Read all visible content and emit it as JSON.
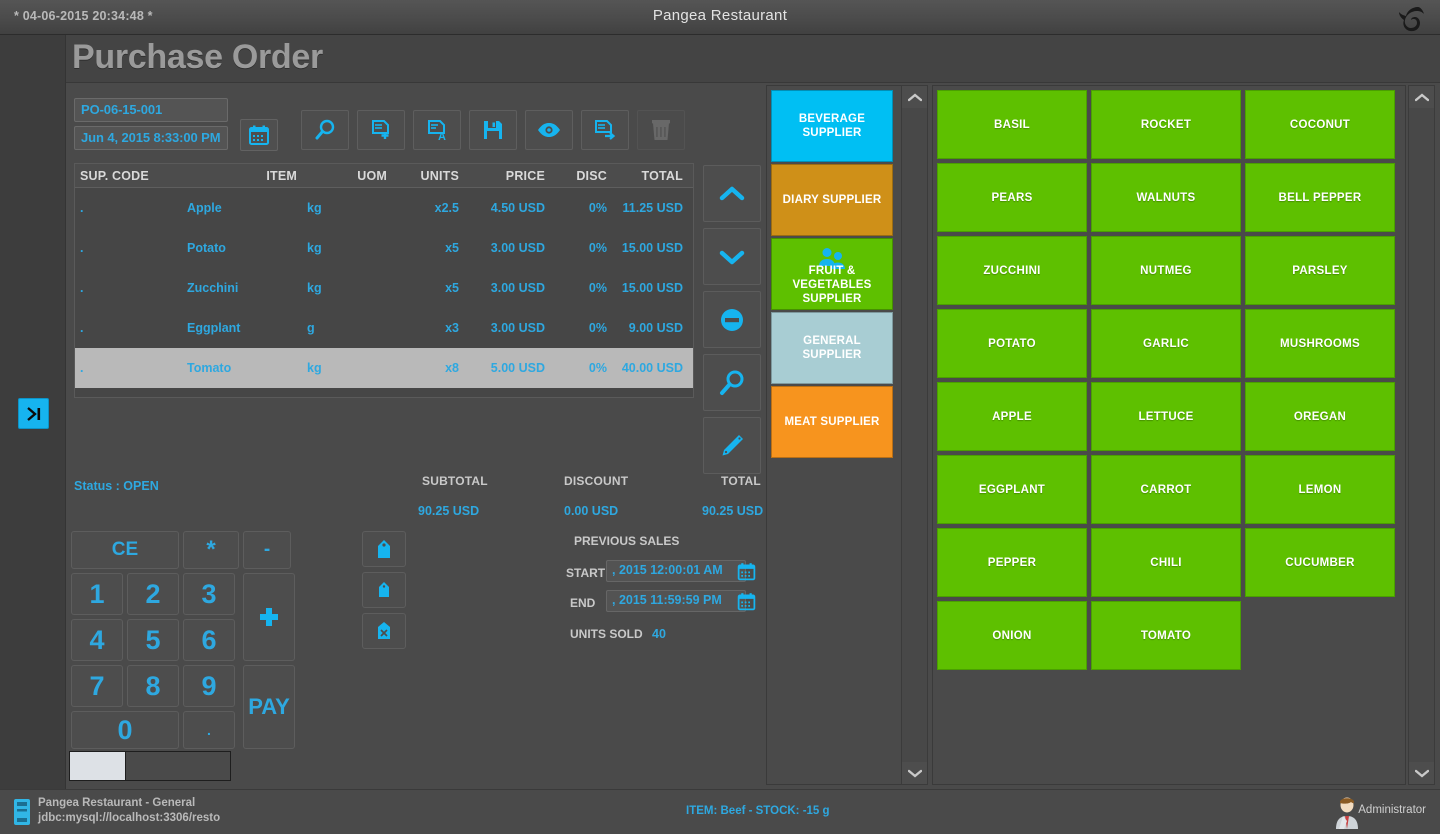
{
  "titlebar": {
    "clock": "* 04-06-2015 20:34:48 *",
    "app_title": "Pangea Restaurant",
    "logo_icon": "bird-logo-icon"
  },
  "header": {
    "page_title": "Purchase Order"
  },
  "left_rail": {
    "expand_icon": "expand-panel-icon"
  },
  "order": {
    "po_code": "PO-06-15-001",
    "po_date": "Jun 4, 2015 8:33:00 PM",
    "calendar_icon": "calendar-icon",
    "toolbar": [
      {
        "name": "search-order-button",
        "icon": "magnifier-icon",
        "disabled": false
      },
      {
        "name": "new-order-button",
        "icon": "document-plus-icon",
        "disabled": false
      },
      {
        "name": "rename-order-button",
        "icon": "document-a-icon",
        "disabled": false
      },
      {
        "name": "save-order-button",
        "icon": "floppy-save-icon",
        "disabled": false
      },
      {
        "name": "preview-order-button",
        "icon": "eye-icon",
        "disabled": false
      },
      {
        "name": "export-order-button",
        "icon": "document-export-icon",
        "disabled": false
      },
      {
        "name": "delete-order-button",
        "icon": "trash-icon",
        "disabled": true
      }
    ],
    "grid": {
      "columns": [
        "SUP. CODE",
        "ITEM",
        "UOM",
        "UNITS",
        "PRICE",
        "DISC",
        "TOTAL"
      ],
      "rows": [
        {
          "sup_code": ".",
          "item": "Apple",
          "uom": "kg",
          "units": "x2.5",
          "price": "4.50 USD",
          "disc": "0%",
          "total": "11.25 USD",
          "selected": false
        },
        {
          "sup_code": ".",
          "item": "Potato",
          "uom": "kg",
          "units": "x5",
          "price": "3.00 USD",
          "disc": "0%",
          "total": "15.00 USD",
          "selected": false
        },
        {
          "sup_code": ".",
          "item": "Zucchini",
          "uom": "kg",
          "units": "x5",
          "price": "3.00 USD",
          "disc": "0%",
          "total": "15.00 USD",
          "selected": false
        },
        {
          "sup_code": ".",
          "item": "Eggplant",
          "uom": "g",
          "units": "x3",
          "price": "3.00 USD",
          "disc": "0%",
          "total": "9.00 USD",
          "selected": false
        },
        {
          "sup_code": ".",
          "item": "Tomato",
          "uom": "kg",
          "units": "x8",
          "price": "5.00 USD",
          "disc": "0%",
          "total": "40.00 USD",
          "selected": true
        }
      ]
    },
    "side_controls": [
      {
        "name": "move-up-button",
        "icon": "chevron-up-icon"
      },
      {
        "name": "move-down-button",
        "icon": "chevron-down-icon"
      },
      {
        "name": "remove-line-button",
        "icon": "minus-circle-icon"
      },
      {
        "name": "search-line-button",
        "icon": "magnifier-icon"
      },
      {
        "name": "edit-line-button",
        "icon": "pencil-icon"
      }
    ],
    "status_label": "Status : OPEN",
    "totals": {
      "subtotal_label": "SUBTOTAL",
      "subtotal_value": "90.25 USD",
      "discount_label": "DISCOUNT",
      "discount_value": "0.00 USD",
      "total_label": "TOTAL",
      "total_value": "90.25 USD"
    },
    "previous_sales": {
      "heading": "PREVIOUS SALES",
      "start_label": "START",
      "start_value": ", 2015 12:00:01 AM",
      "end_label": "END",
      "end_value": ", 2015 11:59:59 PM",
      "units_sold_label": "UNITS SOLD",
      "units_sold_value": "40",
      "calendar_icon": "calendar-icon"
    }
  },
  "keypad": {
    "clear_label": "CE",
    "star_label": "*",
    "minus_label": "-",
    "plus_label": "+",
    "pay_label": "PAY",
    "dot_label": ".",
    "digits": [
      "1",
      "2",
      "3",
      "4",
      "5",
      "6",
      "7",
      "8",
      "9",
      "0"
    ],
    "tag_buttons": [
      {
        "name": "price-tag-button",
        "icon": "tag-icon"
      },
      {
        "name": "small-tag-button",
        "icon": "tag-small-icon"
      },
      {
        "name": "cancel-tag-button",
        "icon": "tag-cancel-icon"
      }
    ]
  },
  "suppliers": {
    "icon": "people-icon",
    "items": [
      {
        "label": "BEVERAGE SUPPLIER",
        "color": "#00bff3",
        "selected": false,
        "icon": null
      },
      {
        "label": "DIARY SUPPLIER",
        "color": "#cf9018",
        "selected": false,
        "icon": null
      },
      {
        "label": "FRUIT & VEGETABLES SUPPLIER",
        "color": "#5ec000",
        "selected": true,
        "icon": "people-icon"
      },
      {
        "label": "GENERAL SUPPLIER",
        "color": "#a8cdd3",
        "selected": false,
        "icon": null
      },
      {
        "label": "MEAT SUPPLIER",
        "color": "#f7941e",
        "selected": false,
        "icon": null
      }
    ]
  },
  "products": {
    "color": "#5ec000",
    "items": [
      "BASIL",
      "ROCKET",
      "COCONUT",
      "PEARS",
      "WALNUTS",
      "BELL PEPPER",
      "ZUCCHINI",
      "NUTMEG",
      "PARSLEY",
      "POTATO",
      "GARLIC",
      "MUSHROOMS",
      "APPLE",
      "LETTUCE",
      "OREGAN",
      "EGGPLANT",
      "CARROT",
      "LEMON",
      "PEPPER",
      "CHILI",
      "CUCUMBER",
      "ONION",
      "TOMATO"
    ]
  },
  "statusbar": {
    "db_icon": "database-icon",
    "db_name": "Pangea Restaurant - General",
    "db_url": "jdbc:mysql://localhost:3306/resto",
    "item_stock": "ITEM: Beef - STOCK: -15 g",
    "user_name": "Administrator",
    "user_icon": "user-avatar-icon"
  }
}
